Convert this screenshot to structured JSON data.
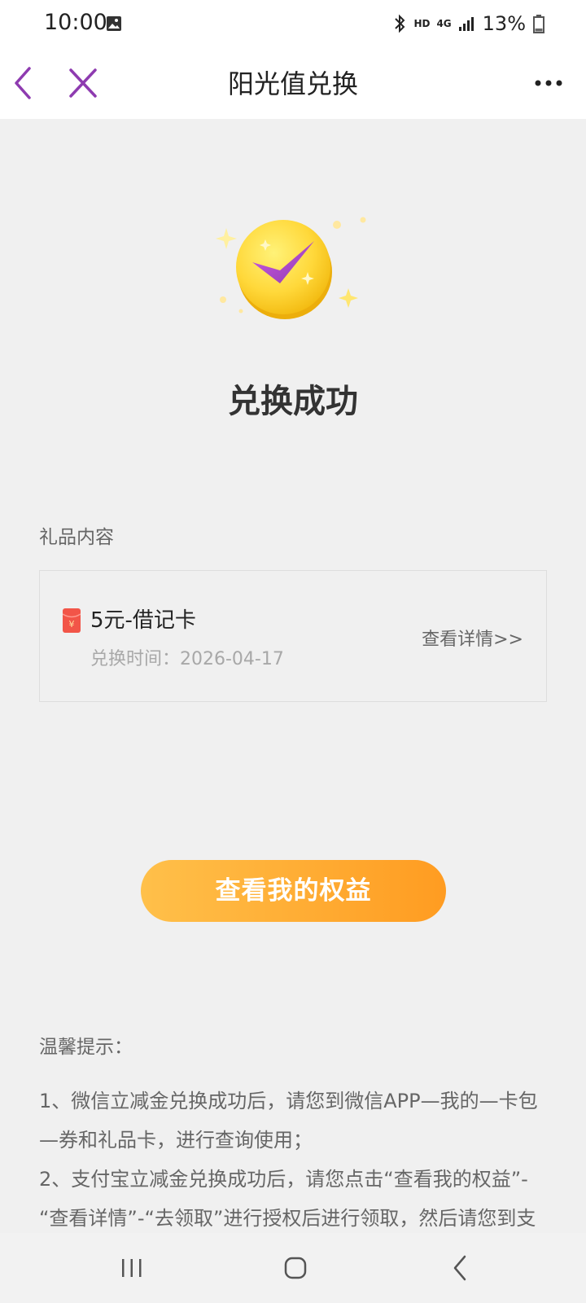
{
  "status_bar": {
    "time": "10:00",
    "battery": "13%",
    "hd_label": "HD",
    "network_label": "4G"
  },
  "nav": {
    "title": "阳光值兑换"
  },
  "result": {
    "title": "兑换成功"
  },
  "gift": {
    "section_label": "礼品内容",
    "name": "5元-借记卡",
    "time": "兑换时间：2026-04-17",
    "detail_link": "查看详情>>"
  },
  "actions": {
    "rights_button": "查看我的权益"
  },
  "tips": {
    "title": "温馨提示：",
    "lines": [
      "1、微信立减金兑换成功后，请您到微信APP—我的—卡包",
      "—券和礼品卡，进行查询使用；",
      "2、支付宝立减金兑换成功后，请您点击“查看我的权益”-",
      "“查看详情”-“去领取”进行授权后进行领取，然后请您到支"
    ]
  },
  "colors": {
    "nav_icon": "#8e3bb0",
    "button_start": "#ffc04a",
    "button_end": "#ff9c21",
    "background": "#f0f0f0"
  },
  "icons": {
    "nav_back": "chevron-left-icon",
    "nav_close": "close-icon",
    "nav_more": "more-icon",
    "success": "success-check-icon",
    "gift": "red-envelope-icon"
  }
}
